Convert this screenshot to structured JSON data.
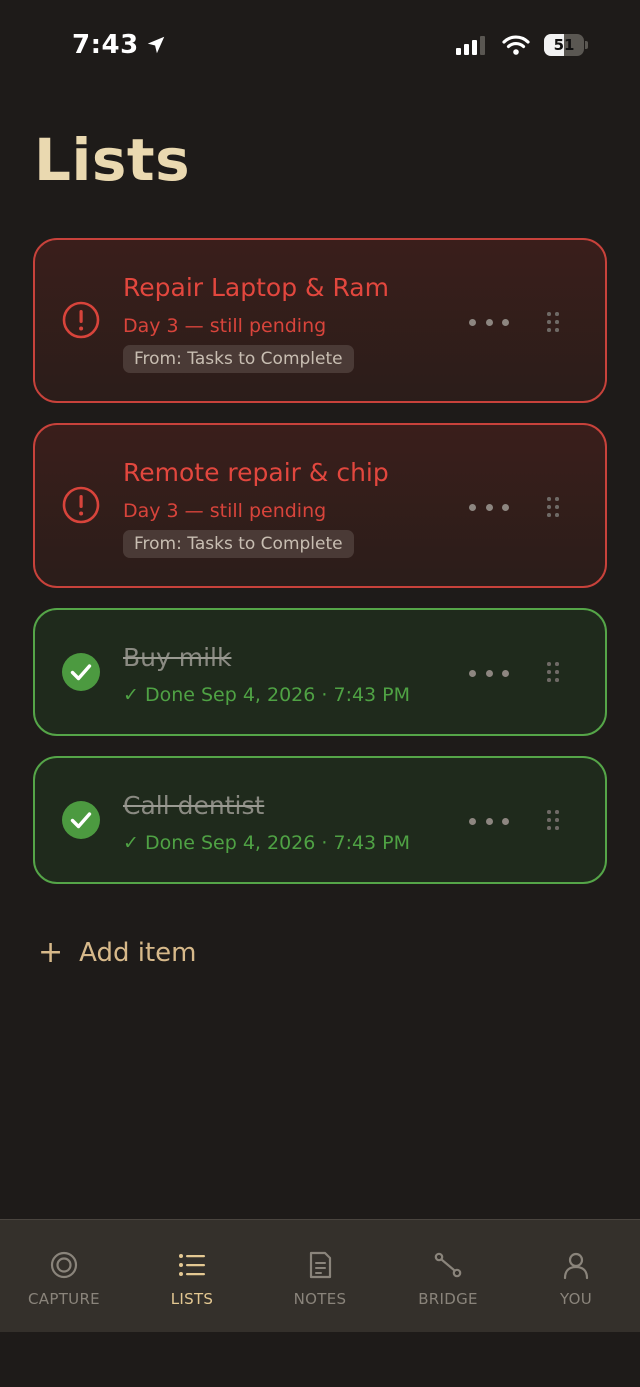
{
  "status_bar": {
    "time": "7:43",
    "battery": "51",
    "battery_level": 0.51
  },
  "page": {
    "title": "Lists"
  },
  "items": [
    {
      "title": "Repair Laptop & Ram",
      "subtitle": "Day 3 — still pending",
      "tag": "From: Tasks to Complete",
      "state": "pending"
    },
    {
      "title": "Remote repair & chip",
      "subtitle": "Day 3 — still pending",
      "tag": "From: Tasks to Complete",
      "state": "pending"
    },
    {
      "title": "Buy milk",
      "subtitle": "✓ Done Sep 4, 2026 · 7:43 PM",
      "state": "done"
    },
    {
      "title": "Call dentist",
      "subtitle": "✓ Done Sep 4, 2026 · 7:43 PM",
      "state": "done"
    }
  ],
  "add_item": {
    "label": "Add item"
  },
  "tabs": [
    {
      "label": "CAPTURE",
      "icon": "capture-icon",
      "active": false
    },
    {
      "label": "LISTS",
      "icon": "list-icon",
      "active": true
    },
    {
      "label": "NOTES",
      "icon": "note-icon",
      "active": false
    },
    {
      "label": "BRIDGE",
      "icon": "bridge-icon",
      "active": false
    },
    {
      "label": "YOU",
      "icon": "user-icon",
      "active": false
    }
  ],
  "colors": {
    "background": "#1e1b19",
    "title": "#ead9b0",
    "pending": "#e2473e",
    "done": "#4fa244",
    "accent": "#e4c892",
    "tab_bar": "#34302b"
  }
}
